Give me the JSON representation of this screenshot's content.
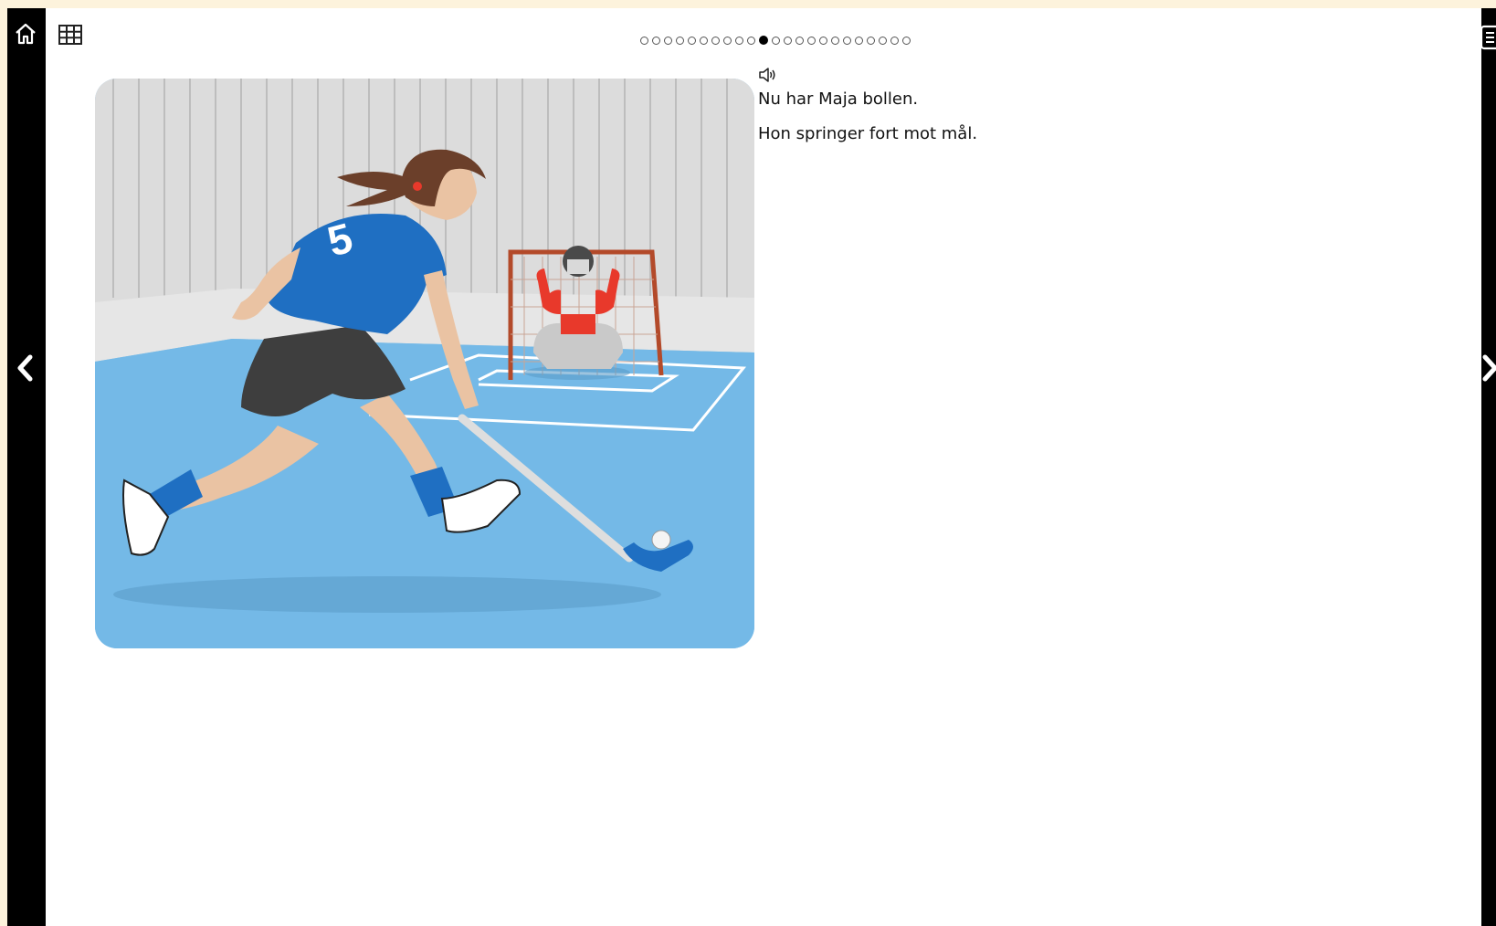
{
  "nav": {
    "home_icon": "home-icon",
    "grid_icon": "grid-icon",
    "prev_icon": "chevron-left-icon",
    "next_icon": "chevron-right-icon",
    "menu_icon": "document-icon"
  },
  "pager": {
    "total": 23,
    "current": 11
  },
  "story": {
    "audio_icon": "speaker-icon",
    "lines": [
      "Nu har Maja bollen.",
      "Hon springer fort mot mål."
    ]
  },
  "illustration": {
    "jersey_number": "5",
    "colors": {
      "floor": "#7ab9e6",
      "jersey": "#1f6fc2",
      "goalie": "#e8392b",
      "wall": "#dcdcdc"
    }
  }
}
